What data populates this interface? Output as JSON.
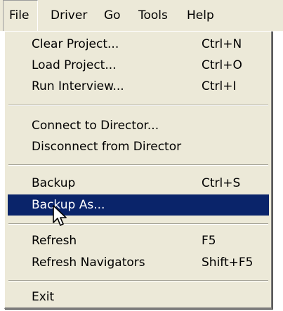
{
  "menubar": {
    "items": [
      {
        "label": "File"
      },
      {
        "label": "Driver"
      },
      {
        "label": "Go"
      },
      {
        "label": "Tools"
      },
      {
        "label": "Help"
      }
    ]
  },
  "file_menu": {
    "clear_project": {
      "label": "Clear Project...",
      "shortcut": "Ctrl+N"
    },
    "load_project": {
      "label": "Load Project...",
      "shortcut": "Ctrl+O"
    },
    "run_interview": {
      "label": "Run Interview...",
      "shortcut": "Ctrl+I"
    },
    "connect_director": {
      "label": "Connect to Director..."
    },
    "disconnect_director": {
      "label": "Disconnect from Director"
    },
    "backup": {
      "label": "Backup",
      "shortcut": "Ctrl+S"
    },
    "backup_as": {
      "label": "Backup As..."
    },
    "refresh": {
      "label": "Refresh",
      "shortcut": "F5"
    },
    "refresh_navigators": {
      "label": "Refresh Navigators",
      "shortcut": "Shift+F5"
    },
    "exit": {
      "label": "Exit"
    }
  },
  "colors": {
    "menu_background": "#ece9d8",
    "highlight_background": "#0a246a",
    "highlight_text": "#ffffff"
  },
  "icons": {
    "cursor": "arrow-pointer-icon"
  }
}
